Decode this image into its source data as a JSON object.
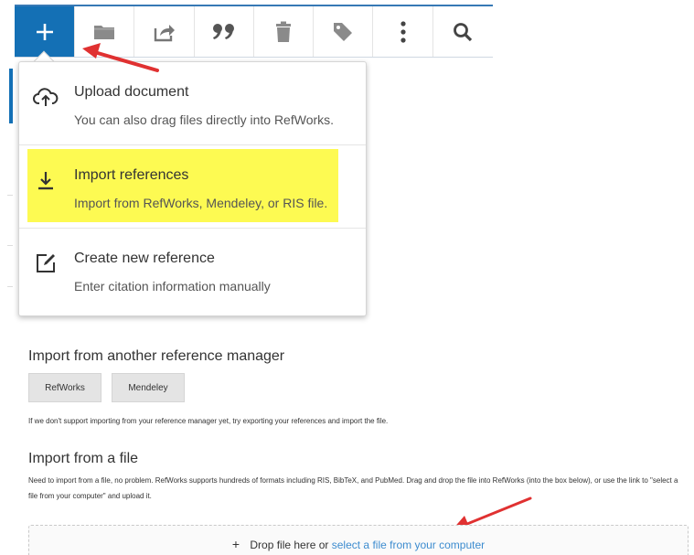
{
  "toolbar": {
    "buttons": [
      {
        "name": "add-icon",
        "active": true
      },
      {
        "name": "folder-icon"
      },
      {
        "name": "share-icon"
      },
      {
        "name": "quote-icon"
      },
      {
        "name": "trash-icon"
      },
      {
        "name": "tag-icon"
      },
      {
        "name": "more-vertical-icon"
      },
      {
        "name": "search-icon"
      }
    ],
    "accent_color": "#1470b5"
  },
  "add_menu": {
    "items": [
      {
        "icon": "cloud-upload-icon",
        "title": "Upload document",
        "subtitle": "You can also drag files directly into RefWorks."
      },
      {
        "icon": "download-icon",
        "title": "Import references",
        "subtitle": "Import from RefWorks, Mendeley, or RIS file.",
        "highlighted": true
      },
      {
        "icon": "edit-icon",
        "title": "Create new reference",
        "subtitle": "Enter citation information manually"
      }
    ],
    "highlight_color": "#fdfa52"
  },
  "import_manager": {
    "title": "Import from another reference manager",
    "buttons": [
      "RefWorks",
      "Mendeley"
    ],
    "note": "If we don't support importing from your reference manager yet, try exporting your references and import the file."
  },
  "import_file": {
    "title": "Import from a file",
    "description": "Need to import from a file, no problem. RefWorks supports hundreds of formats including RIS, BibTeX, and PubMed. Drag and drop the file into RefWorks (into the box below), or use the link to \"select a file from your computer\" and upload it.",
    "dropzone": {
      "plus": "+",
      "text": "Drop file here or",
      "link": "select a file from your computer"
    }
  },
  "annotation_color": "#e03131"
}
